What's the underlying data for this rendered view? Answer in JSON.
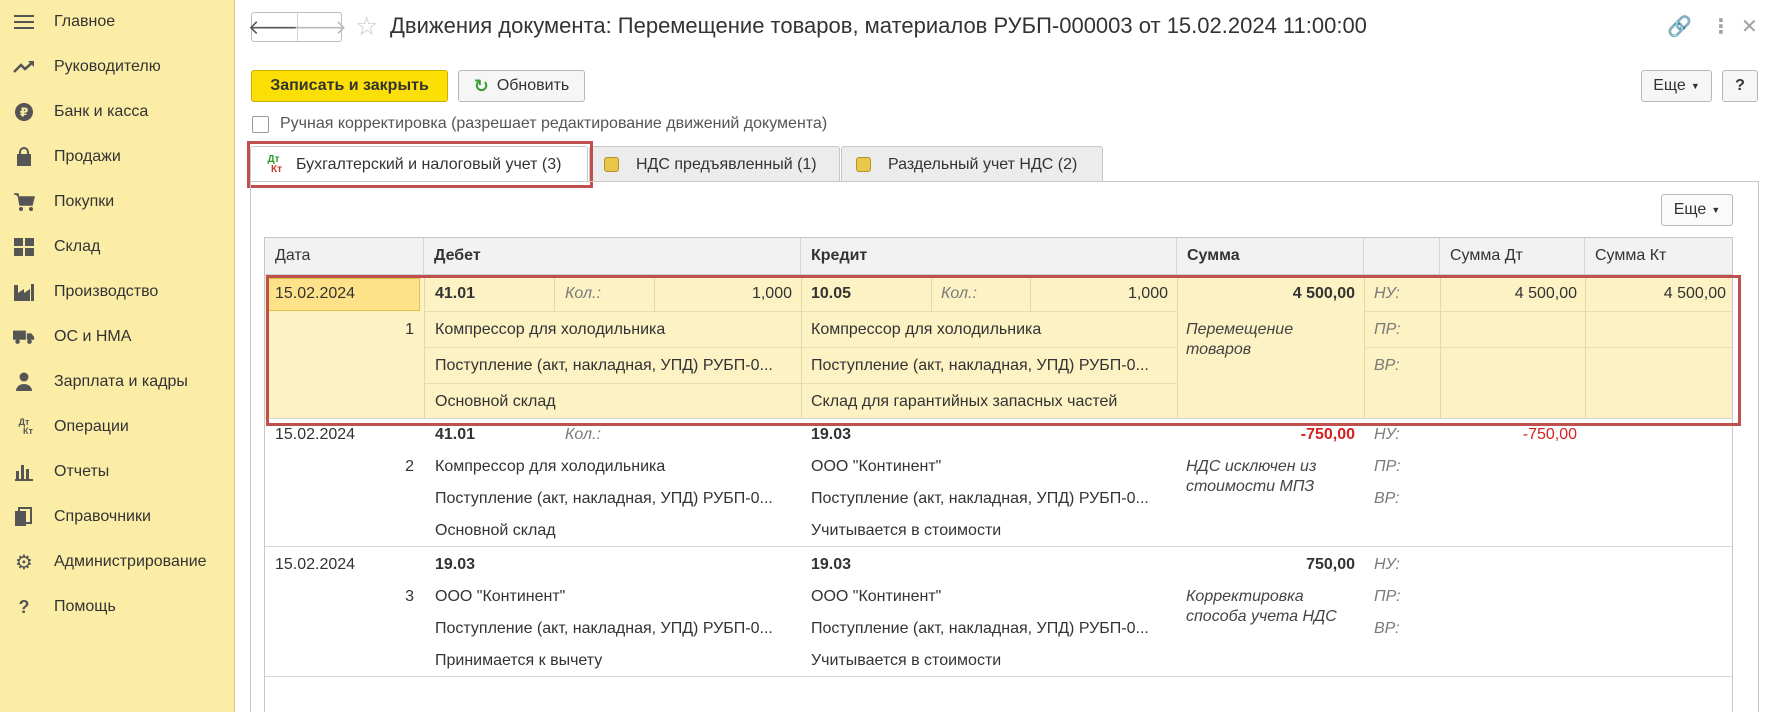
{
  "sidebar": {
    "items": [
      {
        "label": "Главное",
        "icon": "menu-icon"
      },
      {
        "label": "Руководителю",
        "icon": "trend-icon"
      },
      {
        "label": "Банк и касса",
        "icon": "ruble-icon"
      },
      {
        "label": "Продажи",
        "icon": "bag-icon"
      },
      {
        "label": "Покупки",
        "icon": "cart-icon"
      },
      {
        "label": "Склад",
        "icon": "warehouse-icon"
      },
      {
        "label": "Производство",
        "icon": "factory-icon"
      },
      {
        "label": "ОС и НМА",
        "icon": "truck-icon"
      },
      {
        "label": "Зарплата и кадры",
        "icon": "person-icon"
      },
      {
        "label": "Операции",
        "icon": "dtkt-icon"
      },
      {
        "label": "Отчеты",
        "icon": "barchart-icon"
      },
      {
        "label": "Справочники",
        "icon": "books-icon"
      },
      {
        "label": "Администрирование",
        "icon": "gear-icon"
      },
      {
        "label": "Помощь",
        "icon": "help-icon"
      }
    ]
  },
  "header": {
    "title": "Движения документа: Перемещение товаров, материалов РУБП-000003 от 15.02.2024 11:00:00",
    "back_symbol": "🡐",
    "forward_symbol": "🡒",
    "star_symbol": "☆",
    "link_symbol": "🔗",
    "more_symbol": "⋮",
    "close_symbol": "✕"
  },
  "toolbar": {
    "save_close_label": "Записать и закрыть",
    "refresh_label": "Обновить",
    "more_label": "Еще",
    "help_label": "?"
  },
  "manual_correction": {
    "label": "Ручная корректировка (разрешает редактирование движений документа)",
    "checked": false
  },
  "tabs": [
    {
      "label": "Бухгалтерский и налоговый учет (3)",
      "active": true,
      "icon": "dtkt-icon"
    },
    {
      "label": "НДС предъявленный (1)",
      "active": false,
      "icon": "register-icon"
    },
    {
      "label": "Раздельный учет НДС (2)",
      "active": false,
      "icon": "register-icon"
    }
  ],
  "panel": {
    "more_label": "Еще"
  },
  "table": {
    "columns": [
      "Дата",
      "Дебет",
      "Кредит",
      "Сумма",
      "",
      "Сумма Дт",
      "Сумма Кт"
    ],
    "rows": [
      {
        "date": "15.02.2024",
        "num": "1",
        "dt_account": "41.01",
        "dt_qty_label": "Кол.:",
        "dt_qty": "1,000",
        "dt_sub1": "Компрессор для холодильника",
        "dt_sub2": "Поступление (акт, накладная, УПД) РУБП-0...",
        "dt_sub3": "Основной склад",
        "kt_account": "10.05",
        "kt_qty_label": "Кол.:",
        "kt_qty": "1,000",
        "kt_sub1": "Компрессор для холодильника",
        "kt_sub2": "Поступление (акт, накладная, УПД) РУБП-0...",
        "kt_sub3": "Склад для гарантийных запасных частей",
        "sum": "4 500,00",
        "content": "Перемещение товаров",
        "nu": "НУ:",
        "pr": "ПР:",
        "vr": "ВР:",
        "sum_dt": "4 500,00",
        "sum_kt": "4 500,00"
      },
      {
        "date": "15.02.2024",
        "num": "2",
        "dt_account": "41.01",
        "dt_qty_label": "Кол.:",
        "dt_qty": "",
        "dt_sub1": "Компрессор для холодильника",
        "dt_sub2": "Поступление (акт, накладная, УПД) РУБП-0...",
        "dt_sub3": "Основной склад",
        "kt_account": "19.03",
        "kt_qty_label": "",
        "kt_qty": "",
        "kt_sub1": "ООО \"Континент\"",
        "kt_sub2": "Поступление (акт, накладная, УПД) РУБП-0...",
        "kt_sub3": "Учитывается в стоимости",
        "sum": "-750,00",
        "content": "НДС исключен из стоимости МПЗ",
        "nu": "НУ:",
        "pr": "ПР:",
        "vr": "ВР:",
        "sum_dt": "-750,00",
        "sum_kt": ""
      },
      {
        "date": "15.02.2024",
        "num": "3",
        "dt_account": "19.03",
        "dt_qty_label": "",
        "dt_qty": "",
        "dt_sub1": "ООО \"Континент\"",
        "dt_sub2": "Поступление (акт, накладная, УПД) РУБП-0...",
        "dt_sub3": "Принимается к вычету",
        "kt_account": "19.03",
        "kt_qty_label": "",
        "kt_qty": "",
        "kt_sub1": "ООО \"Континент\"",
        "kt_sub2": "Поступление (акт, накладная, УПД) РУБП-0...",
        "kt_sub3": "Учитывается в стоимости",
        "sum": "750,00",
        "content": "Корректировка способа учета НДС",
        "nu": "НУ:",
        "pr": "ПР:",
        "vr": "ВР:",
        "sum_dt": "",
        "sum_kt": ""
      }
    ]
  },
  "colors": {
    "sidebar_bg": "#fbeda6",
    "primary_button": "#fcdf04",
    "selected_row": "#fcf2c4",
    "negative": "#d61f1f",
    "highlight_frame": "#c0504d"
  }
}
